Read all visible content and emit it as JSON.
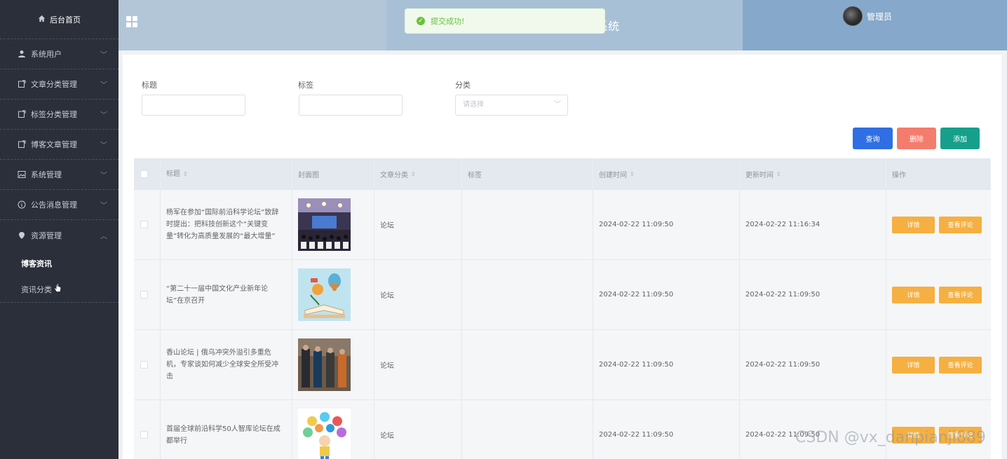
{
  "sidebar": {
    "home_label": "后台首页",
    "items": [
      {
        "label": "系统用户",
        "icon": "user-icon"
      },
      {
        "label": "文章分类管理",
        "icon": "edit-icon"
      },
      {
        "label": "标签分类管理",
        "icon": "edit-icon"
      },
      {
        "label": "博客文章管理",
        "icon": "edit-icon"
      },
      {
        "label": "系统管理",
        "icon": "picture-icon"
      },
      {
        "label": "公告消息管理",
        "icon": "info-icon"
      },
      {
        "label": "资源管理",
        "icon": "location-icon"
      }
    ],
    "subitems": [
      {
        "label": "博客资讯",
        "active": true
      },
      {
        "label": "资讯分类",
        "active": false
      }
    ]
  },
  "header": {
    "title_partial": "系统",
    "admin_name": "管理员"
  },
  "toast": {
    "message": "提交成功!"
  },
  "filters": {
    "title_label": "标题",
    "tag_label": "标签",
    "category_label": "分类",
    "category_placeholder": "请选择"
  },
  "buttons": {
    "query": "查询",
    "delete": "删除",
    "add": "添加"
  },
  "table": {
    "headers": {
      "title": "标题",
      "cover": "封面图",
      "category": "文章分类",
      "tag": "标签",
      "created": "创建时间",
      "updated": "更新时间",
      "ops": "操作"
    },
    "rows": [
      {
        "title": "杨军在参加“国际前沿科学论坛”致辞时提出：把科技创新这个“关键变量”转化为高质量发展的“最大增量”",
        "category": "论坛",
        "tag": "",
        "created": "2024-02-22 11:09:50",
        "updated": "2024-02-22 11:16:34"
      },
      {
        "title": "“第二十一届中国文化产业新年论坛”在京召开",
        "category": "论坛",
        "tag": "",
        "created": "2024-02-22 11:09:50",
        "updated": "2024-02-22 11:09:50"
      },
      {
        "title": "香山论坛 | 俄乌冲突外溢引多重危机，专家谈如何减少全球安全所受冲击",
        "category": "论坛",
        "tag": "",
        "created": "2024-02-22 11:09:50",
        "updated": "2024-02-22 11:09:50"
      },
      {
        "title": "首届全球前沿科学50人智库论坛在成都举行",
        "category": "论坛",
        "tag": "",
        "created": "2024-02-22 11:09:50",
        "updated": "2024-02-22 11:09:50"
      }
    ],
    "detail_label": "详情",
    "comment_label": "查看评论"
  },
  "watermark": "CSDN @vx_danpianji889"
}
